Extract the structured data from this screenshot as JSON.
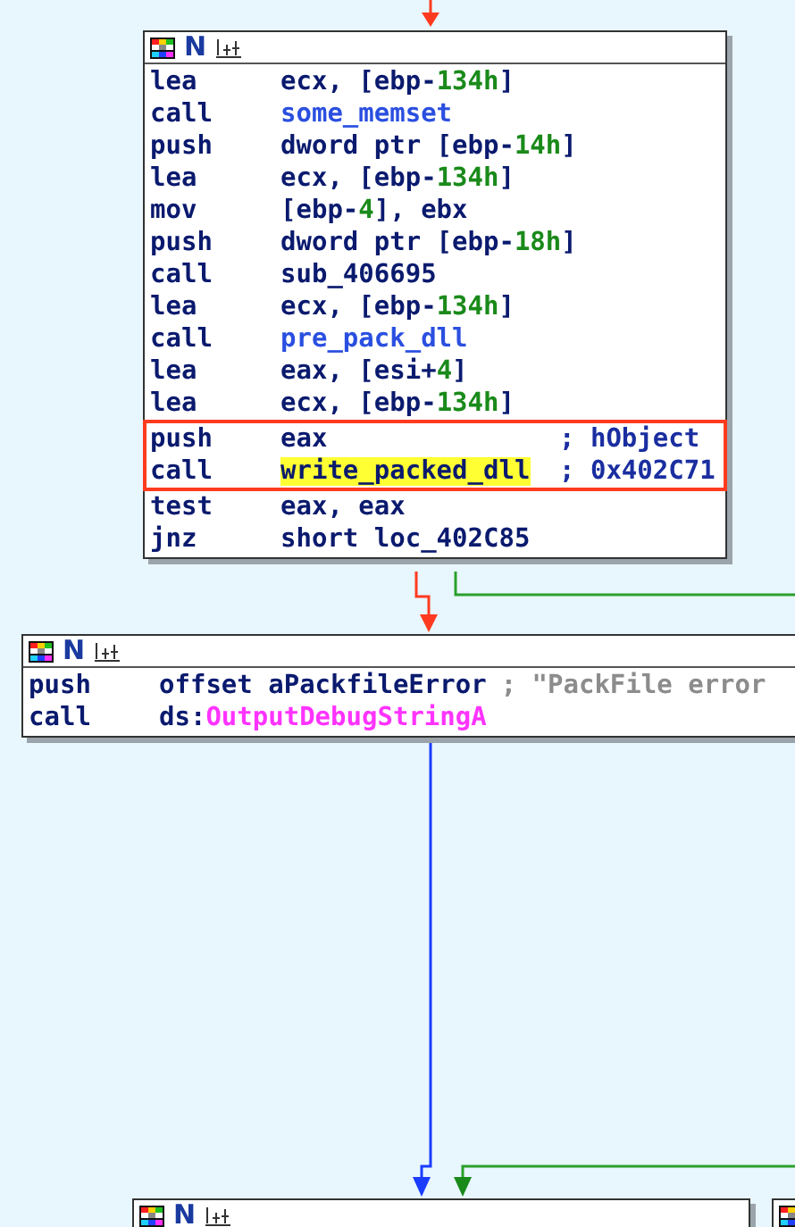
{
  "nodes": [
    {
      "header_mark": "N",
      "lines": [
        {
          "mnemonic": "lea",
          "operands": [
            {
              "text": "ecx, [ebp-",
              "kind": "plain"
            },
            {
              "text": "134h",
              "kind": "number"
            },
            {
              "text": "]",
              "kind": "plain"
            }
          ],
          "selected": false
        },
        {
          "mnemonic": "call",
          "operands": [
            {
              "text": "some_memset",
              "kind": "name"
            }
          ],
          "selected": false
        },
        {
          "mnemonic": "push",
          "operands": [
            {
              "text": "dword ptr [ebp-",
              "kind": "plain"
            },
            {
              "text": "14h",
              "kind": "number"
            },
            {
              "text": "]",
              "kind": "plain"
            }
          ],
          "selected": false
        },
        {
          "mnemonic": "lea",
          "operands": [
            {
              "text": "ecx, [ebp-",
              "kind": "plain"
            },
            {
              "text": "134h",
              "kind": "number"
            },
            {
              "text": "]",
              "kind": "plain"
            }
          ],
          "selected": false
        },
        {
          "mnemonic": "mov",
          "operands": [
            {
              "text": "[ebp-",
              "kind": "plain"
            },
            {
              "text": "4",
              "kind": "number"
            },
            {
              "text": "], ebx",
              "kind": "plain"
            }
          ],
          "selected": false
        },
        {
          "mnemonic": "push",
          "operands": [
            {
              "text": "dword ptr [ebp-",
              "kind": "plain"
            },
            {
              "text": "18h",
              "kind": "number"
            },
            {
              "text": "]",
              "kind": "plain"
            }
          ],
          "selected": false
        },
        {
          "mnemonic": "call",
          "operands": [
            {
              "text": "sub_406695",
              "kind": "plain"
            }
          ],
          "selected": false
        },
        {
          "mnemonic": "lea",
          "operands": [
            {
              "text": "ecx, [ebp-",
              "kind": "plain"
            },
            {
              "text": "134h",
              "kind": "number"
            },
            {
              "text": "]",
              "kind": "plain"
            }
          ],
          "selected": false
        },
        {
          "mnemonic": "call",
          "operands": [
            {
              "text": "pre_pack_dll",
              "kind": "name"
            }
          ],
          "selected": false
        },
        {
          "mnemonic": "lea",
          "operands": [
            {
              "text": "eax, [esi+",
              "kind": "plain"
            },
            {
              "text": "4",
              "kind": "number"
            },
            {
              "text": "]",
              "kind": "plain"
            }
          ],
          "selected": false
        },
        {
          "mnemonic": "lea",
          "operands": [
            {
              "text": "ecx, [ebp-",
              "kind": "plain"
            },
            {
              "text": "134h",
              "kind": "number"
            },
            {
              "text": "]",
              "kind": "plain"
            }
          ],
          "selected": false
        },
        {
          "mnemonic": "push",
          "operands": [
            {
              "text": "eax",
              "kind": "plain"
            },
            {
              "text": "; hObject",
              "kind": "comment"
            }
          ],
          "selected": true
        },
        {
          "mnemonic": "call",
          "operands": [
            {
              "text": "write_packed_dll",
              "kind": "highlight"
            },
            {
              "text": "; 0x402C71",
              "kind": "comment"
            }
          ],
          "selected": true
        },
        {
          "mnemonic": "test",
          "operands": [
            {
              "text": "eax, eax",
              "kind": "plain"
            }
          ],
          "selected": false
        },
        {
          "mnemonic": "jnz",
          "operands": [
            {
              "text": "short loc_402C85",
              "kind": "plain"
            }
          ],
          "selected": false
        }
      ]
    },
    {
      "header_mark": "N",
      "lines": [
        {
          "mnemonic": "push",
          "operands": [
            {
              "text": "offset aPackfileError",
              "kind": "plain"
            },
            {
              "text": "; \"PackFile error",
              "kind": "string"
            }
          ],
          "selected": false
        },
        {
          "mnemonic": "call",
          "operands": [
            {
              "text": "ds:",
              "kind": "plain"
            },
            {
              "text": "OutputDebugStringA",
              "kind": "import"
            }
          ],
          "selected": false
        }
      ]
    },
    {
      "header_mark": "N"
    }
  ]
}
